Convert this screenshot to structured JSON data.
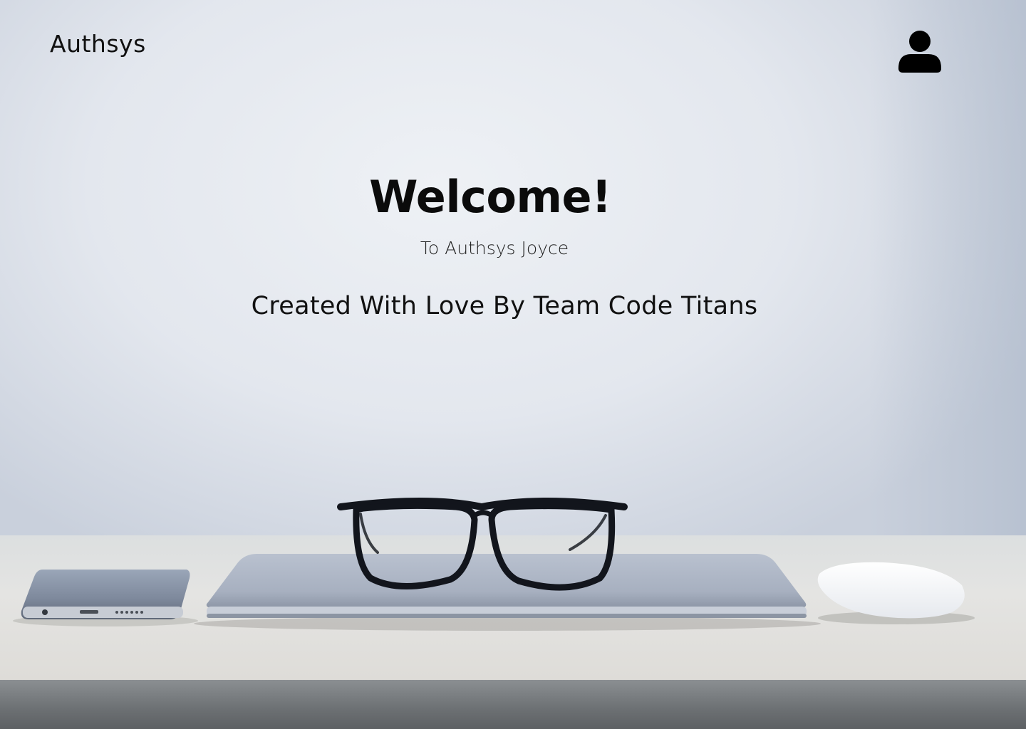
{
  "header": {
    "brand": "Authsys",
    "profile_icon": "user-icon"
  },
  "hero": {
    "title": "Welcome!",
    "subtitle": "To Authsys Joyce",
    "credit": "Created With Love By Team Code Titans"
  },
  "colors": {
    "text": "#0b0b0b",
    "wall": "#e4e8ee",
    "desk": "#dedcd8"
  }
}
